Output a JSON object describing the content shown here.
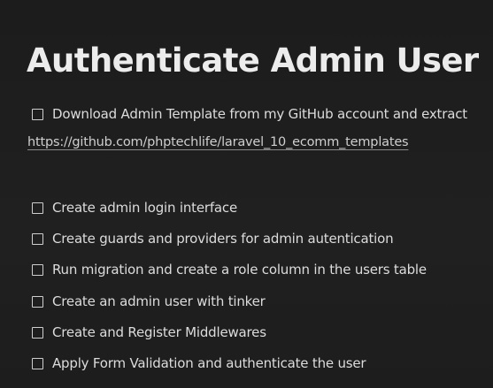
{
  "page": {
    "title": "Authenticate Admin User"
  },
  "intro": {
    "task": {
      "label": "Download Admin Template from my GitHub account and extract",
      "checked": false
    },
    "link": "https://github.com/phptechlife/laravel_10_ecomm_templates"
  },
  "tasks": [
    {
      "label": "Create admin login interface",
      "checked": false
    },
    {
      "label": "Create guards and providers for admin autentication",
      "checked": false
    },
    {
      "label": "Run migration and create a role column in the users table",
      "checked": false
    },
    {
      "label": "Create an admin user with tinker",
      "checked": false
    },
    {
      "label": "Create and Register Middlewares",
      "checked": false
    },
    {
      "label": "Apply Form Validation and authenticate the user",
      "checked": false
    }
  ],
  "colors": {
    "background": "#1e1e1e",
    "text": "#e6e6e6",
    "checkbox_border": "#cfcfcf"
  }
}
